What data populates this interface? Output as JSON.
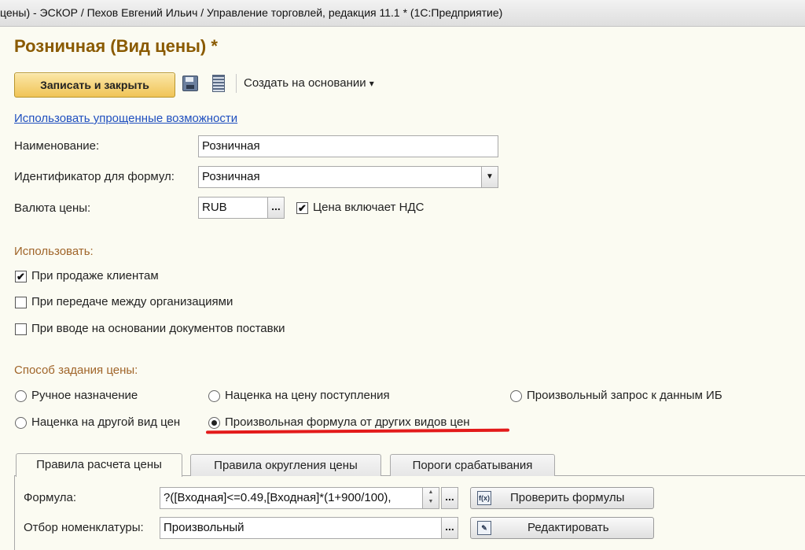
{
  "window": {
    "title": "цены) - ЭСКОР / Пехов Евгений Ильич / Управление торговлей, редакция 11.1 *  (1С:Предприятие)"
  },
  "form": {
    "title": "Розничная (Вид цены) *"
  },
  "toolbar": {
    "save_close_label": "Записать и закрыть",
    "create_based_label": "Создать на основании",
    "create_based_arrow": "▾"
  },
  "simplified_link": "Использовать упрощенные возможности",
  "fields": {
    "name_label": "Наименование:",
    "name_value": "Розничная",
    "formula_id_label": "Идентификатор для формул:",
    "formula_id_value": "Розничная",
    "currency_label": "Валюта цены:",
    "currency_value": "RUB",
    "vat_label": "Цена включает НДС",
    "vat_checked": true,
    "dots": "..."
  },
  "use_section": {
    "heading": "Использовать:",
    "options": [
      {
        "label": "При продаже клиентам",
        "checked": true
      },
      {
        "label": "При передаче между организациями",
        "checked": false
      },
      {
        "label": "При вводе на основании документов поставки",
        "checked": false
      }
    ]
  },
  "price_method": {
    "heading": "Способ задания цены:",
    "options": [
      {
        "label": "Ручное назначение",
        "selected": false
      },
      {
        "label": "Наценка на цену поступления",
        "selected": false
      },
      {
        "label": "Произвольный запрос к данным ИБ",
        "selected": false
      },
      {
        "label": "Наценка на другой вид цен",
        "selected": false
      },
      {
        "label": "Произвольная формула от других видов цен",
        "selected": true
      }
    ]
  },
  "tabs": [
    {
      "label": "Правила расчета цены",
      "active": true
    },
    {
      "label": "Правила округления цены",
      "active": false
    },
    {
      "label": "Пороги срабатывания",
      "active": false
    }
  ],
  "rules": {
    "formula_label": "Формула:",
    "formula_value": "?([Входная]<=0.49,[Входная]*(1+900/100),",
    "check_button": "Проверить формулы",
    "filter_label": "Отбор номенклатуры:",
    "filter_value": "Произвольный",
    "edit_button": "Редактировать",
    "fx_icon_text": "f(x)",
    "spin_up": "▲",
    "spin_down": "▼"
  },
  "colors": {
    "title_color": "#8a5a00",
    "section_heading": "#a0652a",
    "primary_button": "#f0c457",
    "link": "#1f4fbf",
    "highlight_underline": "#e31a1a"
  },
  "icons": [
    "save-icon",
    "list-icon",
    "check-formula-icon",
    "edit-icon",
    "dropdown-arrow-icon",
    "spin-icon"
  ]
}
